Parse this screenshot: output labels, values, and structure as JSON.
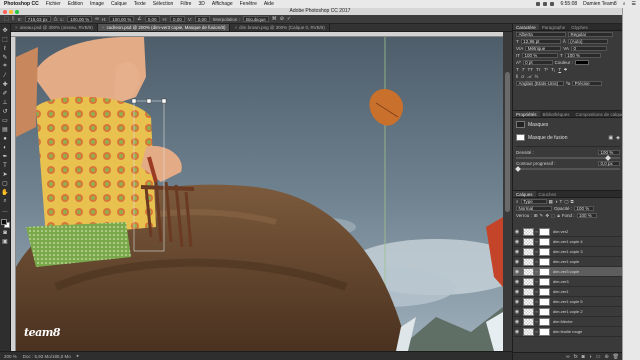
{
  "menubar": {
    "items": [
      "Photoshop CC",
      "Fichier",
      "Edition",
      "Image",
      "Calque",
      "Texte",
      "Sélection",
      "Filtre",
      "3D",
      "Affichage",
      "Fenêtre",
      "Aide"
    ],
    "time": "6:55:08",
    "user": "Damien Team8"
  },
  "window": {
    "title": "Adobe Photoshop CC 2017"
  },
  "options": {
    "x_label": "X:",
    "x_value": "715,03 px",
    "w_label": "L:",
    "w_value": "100,00 %",
    "h_label": "H:",
    "h_value": "100,00 %",
    "angle_value": "0,00",
    "hskew_value": "0,00",
    "vskew_value": "0,00",
    "interp_label": "Interpolation :",
    "interp_value": "Bicubique"
  },
  "tabs": [
    {
      "label": "oiseau.psd @ 300% (oiseau, RVB/8)",
      "active": false
    },
    {
      "label": "cadreon.psd @ 200% (dim-ver3 copie, Masque de fusion/8)",
      "active": true
    },
    {
      "label": "dim brown.png @ 300% (Calque 0, RVB/8)",
      "active": false
    }
  ],
  "status": {
    "zoom": "200 %",
    "doc": "Doc : 5,93 Mo/185,0 Mo"
  },
  "watermark": "team8",
  "panels": {
    "char_tabs": [
      "Caractère",
      "Paragraphe",
      "Glyphes"
    ],
    "font_family": "Alberta",
    "font_style": "Regular",
    "font_size": "12,96 pt",
    "leading": "(Auto)",
    "kerning": "Métrique",
    "tracking": "0",
    "vscale": "100 %",
    "hscale": "100 %",
    "baseline": "0 pt",
    "color_label": "Couleur :",
    "language": "Anglais (Etats-Unis)",
    "aa": "Précise",
    "props_tabs": [
      "Propriétés",
      "Bibliothèques",
      "Compositions de calque"
    ],
    "props_title": "Masques",
    "mask_label": "Masque de fusion",
    "density_label": "Densité :",
    "density_value": "100 %",
    "feather_label": "Contour progressif :",
    "feather_value": "0,0 px",
    "layers_tabs": [
      "Calques",
      "Couches"
    ],
    "filter_type": "Type",
    "blend_mode": "Normal",
    "opacity_label": "Opacité :",
    "opacity_value": "100 %",
    "lock_label": "Verrou :",
    "fill_label": "Fond :",
    "fill_value": "100 %",
    "layers": [
      {
        "name": "dim ver2",
        "selected": false
      },
      {
        "name": "dim-ver1 copie 4",
        "selected": false
      },
      {
        "name": "dim-ver1 copie 3",
        "selected": false
      },
      {
        "name": "dim-ver1 copie",
        "selected": false
      },
      {
        "name": "dim-ver3 copie",
        "selected": true
      },
      {
        "name": "dim-ver3",
        "selected": false
      },
      {
        "name": "dim-ver1",
        "selected": false
      },
      {
        "name": "dim-ver1 copie 5",
        "selected": false
      },
      {
        "name": "dim-ver1 copie 2",
        "selected": false
      },
      {
        "name": "dim Mèche",
        "selected": false
      },
      {
        "name": "dim feuille rouge",
        "selected": false
      }
    ]
  },
  "colors": {
    "accent": "#e8822a",
    "sky": "#5a6a78",
    "fur": "#6b4a30"
  }
}
